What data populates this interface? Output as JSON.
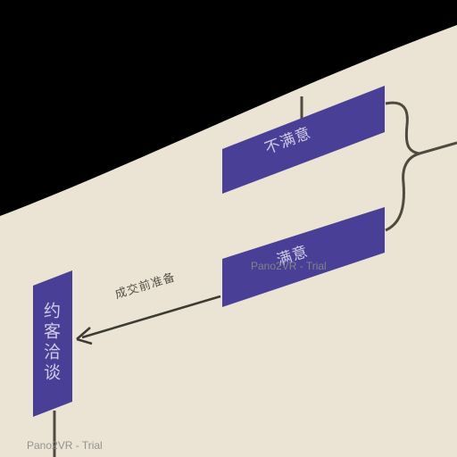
{
  "nodes": {
    "dissatisfied": "不满意",
    "satisfied": "满意",
    "appointment": "约客洽谈"
  },
  "edges": {
    "pre_deal": "成交前准备"
  },
  "watermark": "Pano2VR - Trial",
  "colors": {
    "background": "#000000",
    "paper": "#ebe4d5",
    "node_fill": "#4a3f96",
    "connector": "#4f4a40"
  }
}
